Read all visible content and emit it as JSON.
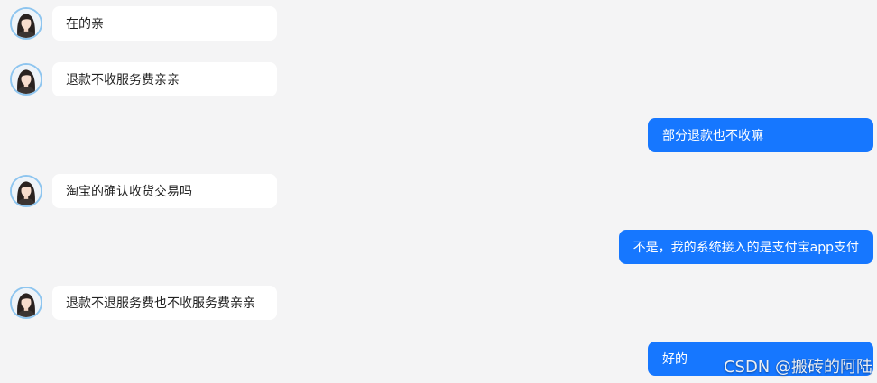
{
  "conversation": {
    "messages": [
      {
        "sender": "agent",
        "text": "在的亲"
      },
      {
        "sender": "agent",
        "text": "退款不收服务费亲亲"
      },
      {
        "sender": "user",
        "text": "部分退款也不收嘛"
      },
      {
        "sender": "agent",
        "text": "淘宝的确认收货交易吗"
      },
      {
        "sender": "user",
        "text": "不是，我的系统接入的是支付宝app支付"
      },
      {
        "sender": "agent",
        "text": "退款不退服务费也不收服务费亲亲"
      },
      {
        "sender": "user",
        "text": "好的"
      }
    ]
  },
  "watermark": "CSDN @搬砖的阿陆",
  "colors": {
    "background": "#f4f4f5",
    "incoming_bubble": "#ffffff",
    "outgoing_bubble": "#1677ff",
    "avatar_border": "#8ec5ef"
  },
  "icons": {
    "agent_avatar": "agent-avatar-photo"
  }
}
